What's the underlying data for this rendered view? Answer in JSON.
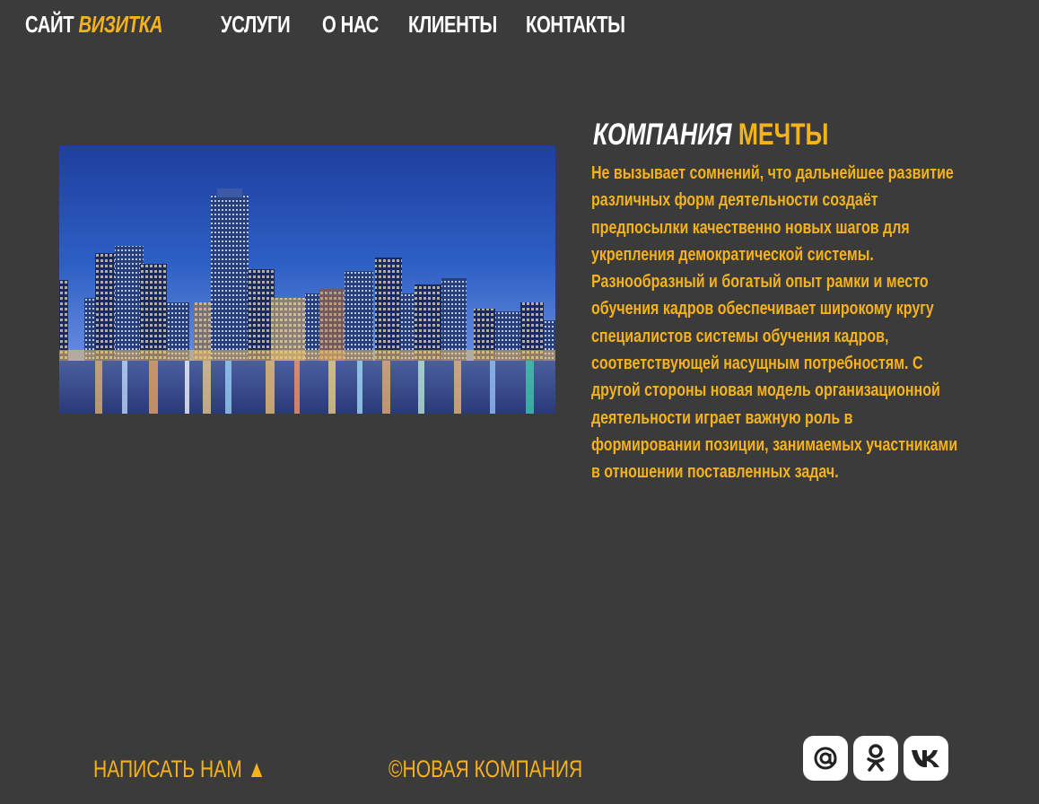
{
  "header": {
    "logo_main": "САЙТ",
    "logo_accent": "ВИЗИТКА",
    "nav": [
      {
        "label": "УСЛУГИ"
      },
      {
        "label": "О НАС"
      },
      {
        "label": "КЛИЕНТЫ"
      },
      {
        "label": "КОНТАКТЫ"
      }
    ]
  },
  "hero": {
    "image_icon": "city-skyline-image"
  },
  "main": {
    "heading_part1": "КОМПАНИЯ",
    "heading_part2": "МЕЧТЫ",
    "body": "Не вызывает сомнений, что дальнейшее развитие различных форм деятельности создаёт предпосылки качественно новых шагов для укрепления демократической системы. Разнообразный и богатый опыт рамки и место обучения кадров обеспечивает широкому кругу специалистов системы обучения кадров, соответствующей насущным потребностям. С другой стороны новая модель организационной деятельности играет важную роль в формировании позиции, занимаемых участниками в отношении поставленных задач."
  },
  "footer": {
    "write_us": "НАПИСАТЬ НАМ ▲",
    "copyright": "©НОВАЯ КОМПАНИЯ",
    "socials": [
      {
        "icon": "mail-icon"
      },
      {
        "icon": "odnoklassniki-icon"
      },
      {
        "icon": "vk-icon"
      }
    ]
  },
  "colors": {
    "background": "#3b3b3b",
    "accent": "#f5b21a",
    "text_light": "#ffffff"
  }
}
